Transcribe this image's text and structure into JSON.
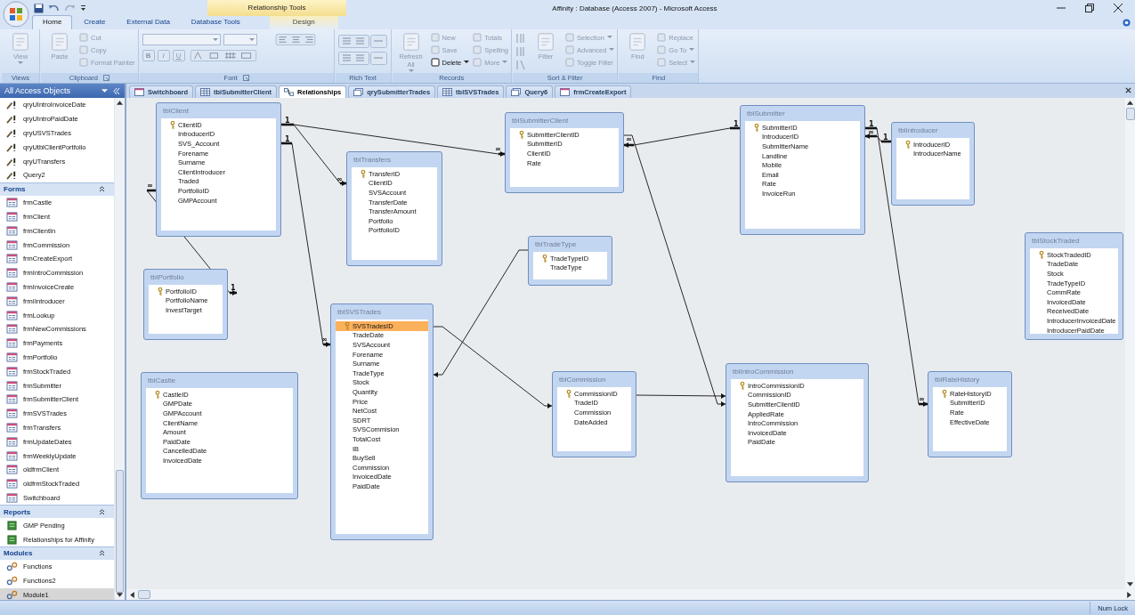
{
  "window": {
    "title": "Affinity : Database (Access 2007)  -  Microsoft Access",
    "context_group": "Relationship Tools"
  },
  "ribbon": {
    "tabs": [
      {
        "label": "Home",
        "selected": true,
        "contextual": false
      },
      {
        "label": "Create",
        "selected": false,
        "contextual": false
      },
      {
        "label": "External Data",
        "selected": false,
        "contextual": false
      },
      {
        "label": "Database Tools",
        "selected": false,
        "contextual": false
      },
      {
        "label": "Design",
        "selected": false,
        "contextual": true
      }
    ],
    "groups": [
      {
        "label": "Views",
        "launcher": false,
        "columns": [
          {
            "kind": "large",
            "items": [
              {
                "label": "View",
                "disabled": true,
                "dropdown": true
              }
            ]
          }
        ]
      },
      {
        "label": "Clipboard",
        "launcher": true,
        "columns": [
          {
            "kind": "large",
            "items": [
              {
                "label": "Paste",
                "disabled": true,
                "dropdown": false
              }
            ]
          },
          {
            "kind": "small",
            "items": [
              {
                "label": "Cut",
                "disabled": true,
                "dropdown": false
              },
              {
                "label": "Copy",
                "disabled": true,
                "dropdown": false
              },
              {
                "label": "Format Painter",
                "disabled": true,
                "dropdown": false
              }
            ]
          }
        ]
      },
      {
        "label": "Font",
        "launcher": true,
        "columns": [
          {
            "kind": "font",
            "items": [
              {
                "label": "B",
                "disabled": true,
                "dropdown": false
              },
              {
                "label": "I",
                "disabled": true,
                "dropdown": false
              },
              {
                "label": "U",
                "disabled": true,
                "dropdown": false
              }
            ]
          }
        ]
      },
      {
        "label": "Rich Text",
        "launcher": false,
        "columns": [
          {
            "kind": "richtext"
          }
        ]
      },
      {
        "label": "Records",
        "launcher": false,
        "columns": [
          {
            "kind": "large",
            "items": [
              {
                "label": "Refresh All",
                "disabled": true,
                "dropdown": true
              }
            ]
          },
          {
            "kind": "small",
            "items": [
              {
                "label": "New",
                "disabled": true,
                "dropdown": false
              },
              {
                "label": "Save",
                "disabled": true,
                "dropdown": false
              },
              {
                "label": "Delete",
                "disabled": false,
                "dropdown": true
              }
            ]
          },
          {
            "kind": "small",
            "items": [
              {
                "label": "Totals",
                "disabled": true,
                "dropdown": false
              },
              {
                "label": "Spelling",
                "disabled": true,
                "dropdown": false
              },
              {
                "label": "More",
                "disabled": true,
                "dropdown": true
              }
            ]
          }
        ]
      },
      {
        "label": "Sort & Filter",
        "launcher": false,
        "columns": [
          {
            "kind": "sort"
          },
          {
            "kind": "large",
            "items": [
              {
                "label": "Filter",
                "disabled": true,
                "dropdown": false
              }
            ]
          },
          {
            "kind": "small",
            "items": [
              {
                "label": "Selection",
                "disabled": true,
                "dropdown": true
              },
              {
                "label": "Advanced",
                "disabled": true,
                "dropdown": true
              },
              {
                "label": "Toggle Filter",
                "disabled": true,
                "dropdown": false
              }
            ]
          }
        ]
      },
      {
        "label": "Find",
        "launcher": false,
        "columns": [
          {
            "kind": "large",
            "items": [
              {
                "label": "Find",
                "disabled": true,
                "dropdown": false
              }
            ]
          },
          {
            "kind": "small",
            "items": [
              {
                "label": "Replace",
                "disabled": true,
                "dropdown": false
              },
              {
                "label": "Go To",
                "disabled": true,
                "dropdown": true
              },
              {
                "label": "Select",
                "disabled": true,
                "dropdown": true
              }
            ]
          }
        ]
      }
    ]
  },
  "navigation": {
    "title": "All Access Objects",
    "groups": [
      {
        "kind": "query",
        "items": [
          {
            "label": "qryUIntroInvoiceDate",
            "selected": false
          },
          {
            "label": "qryUIntroPaidDate",
            "selected": false
          },
          {
            "label": "qryUSVSTrades",
            "selected": false
          },
          {
            "label": "qryUtblClientPortfolio",
            "selected": false
          },
          {
            "label": "qryUTransfers",
            "selected": false
          },
          {
            "label": "Query2",
            "selected": false
          }
        ]
      },
      {
        "title": "Forms",
        "kind": "form",
        "items": [
          {
            "label": "frmCastle",
            "selected": false
          },
          {
            "label": "frmClient",
            "selected": false
          },
          {
            "label": "frmClientIn",
            "selected": false
          },
          {
            "label": "frmCommission",
            "selected": false
          },
          {
            "label": "frmCreateExport",
            "selected": false
          },
          {
            "label": "frmIntroCommission",
            "selected": false
          },
          {
            "label": "frmInvoiceCreate",
            "selected": false
          },
          {
            "label": "frmIIntroducer",
            "selected": false
          },
          {
            "label": "frmLookup",
            "selected": false
          },
          {
            "label": "frmNewCommissions",
            "selected": false
          },
          {
            "label": "frmPayments",
            "selected": false
          },
          {
            "label": "frmPortfolio",
            "selected": false
          },
          {
            "label": "frmStockTraded",
            "selected": false
          },
          {
            "label": "frmSubmitter",
            "selected": false
          },
          {
            "label": "frmSubmitterClient",
            "selected": false
          },
          {
            "label": "frmSVSTrades",
            "selected": false
          },
          {
            "label": "frmTransfers",
            "selected": false
          },
          {
            "label": "frmUpdateDates",
            "selected": false
          },
          {
            "label": "frmWeeklyUpdate",
            "selected": false
          },
          {
            "label": "oldfrmClient",
            "selected": false
          },
          {
            "label": "oldfrmStockTraded",
            "selected": false
          },
          {
            "label": "Switchboard",
            "selected": false
          }
        ]
      },
      {
        "title": "Reports",
        "kind": "report",
        "items": [
          {
            "label": "GMP Pending",
            "selected": false
          },
          {
            "label": "Relationships for Affinity",
            "selected": false
          }
        ]
      },
      {
        "title": "Modules",
        "kind": "module",
        "items": [
          {
            "label": "Functions",
            "selected": false
          },
          {
            "label": "Functions2",
            "selected": false
          },
          {
            "label": "Module1",
            "selected": true
          }
        ]
      }
    ]
  },
  "document_tabs": [
    {
      "label": "Switchboard",
      "kind": "form",
      "selected": false
    },
    {
      "label": "tblSubmitterClient",
      "kind": "table",
      "selected": false
    },
    {
      "label": "Relationships",
      "kind": "relationships",
      "selected": true
    },
    {
      "label": "qrySubmitterTrades",
      "kind": "query",
      "selected": false
    },
    {
      "label": "tblSVSTrades",
      "kind": "table",
      "selected": false
    },
    {
      "label": "Query6",
      "kind": "query",
      "selected": false
    },
    {
      "label": "frmCreateExport",
      "kind": "form",
      "selected": false
    }
  ],
  "tables": [
    {
      "title": "tblClient",
      "fields": [
        {
          "name": "ClientID",
          "key": true,
          "selected": false
        },
        {
          "name": "IntroducerID",
          "key": false,
          "selected": false
        },
        {
          "name": "SVS_Account",
          "key": false,
          "selected": false
        },
        {
          "name": "Forename",
          "key": false,
          "selected": false
        },
        {
          "name": "Surname",
          "key": false,
          "selected": false
        },
        {
          "name": "ClientIntroducer",
          "key": false,
          "selected": false
        },
        {
          "name": "Traded",
          "key": false,
          "selected": false
        },
        {
          "name": "PortfolioID",
          "key": false,
          "selected": false
        },
        {
          "name": "GMPAccount",
          "key": false,
          "selected": false
        }
      ]
    },
    {
      "title": "tblTransfers",
      "fields": [
        {
          "name": "TransferID",
          "key": true,
          "selected": false
        },
        {
          "name": "ClientID",
          "key": false,
          "selected": false
        },
        {
          "name": "SVSAccount",
          "key": false,
          "selected": false
        },
        {
          "name": "TransferDate",
          "key": false,
          "selected": false
        },
        {
          "name": "TransferAmount",
          "key": false,
          "selected": false
        },
        {
          "name": "Portfolio",
          "key": false,
          "selected": false
        },
        {
          "name": "PortfolioID",
          "key": false,
          "selected": false
        }
      ]
    },
    {
      "title": "tblSubmitterClient",
      "fields": [
        {
          "name": "SubmitterClientID",
          "key": true,
          "selected": false
        },
        {
          "name": "SubmitterID",
          "key": false,
          "selected": false
        },
        {
          "name": "ClientID",
          "key": false,
          "selected": false
        },
        {
          "name": "Rate",
          "key": false,
          "selected": false
        }
      ]
    },
    {
      "title": "tblSubmitter",
      "fields": [
        {
          "name": "SubmitterID",
          "key": true,
          "selected": false
        },
        {
          "name": "IntroducerID",
          "key": false,
          "selected": false
        },
        {
          "name": "SubmitterName",
          "key": false,
          "selected": false
        },
        {
          "name": "Landline",
          "key": false,
          "selected": false
        },
        {
          "name": "Mobile",
          "key": false,
          "selected": false
        },
        {
          "name": "Email",
          "key": false,
          "selected": false
        },
        {
          "name": "Rate",
          "key": false,
          "selected": false
        },
        {
          "name": "InvoiceRun",
          "key": false,
          "selected": false
        }
      ]
    },
    {
      "title": "tblIntroducer",
      "fields": [
        {
          "name": "IntroducerID",
          "key": true,
          "selected": false
        },
        {
          "name": "IntroducerName",
          "key": false,
          "selected": false
        }
      ]
    },
    {
      "title": "tblPortfolio",
      "fields": [
        {
          "name": "PortfolioID",
          "key": true,
          "selected": false
        },
        {
          "name": "PortfolioName",
          "key": false,
          "selected": false
        },
        {
          "name": "InvestTarget",
          "key": false,
          "selected": false
        }
      ]
    },
    {
      "title": "tblTradeType",
      "fields": [
        {
          "name": "TradeTypeID",
          "key": true,
          "selected": false
        },
        {
          "name": "TradeType",
          "key": false,
          "selected": false
        }
      ]
    },
    {
      "title": "tblSVSTrades",
      "fields": [
        {
          "name": "SVSTradesID",
          "key": true,
          "selected": true
        },
        {
          "name": "TradeDate",
          "key": false,
          "selected": false
        },
        {
          "name": "SVSAccount",
          "key": false,
          "selected": false
        },
        {
          "name": "Forename",
          "key": false,
          "selected": false
        },
        {
          "name": "Surname",
          "key": false,
          "selected": false
        },
        {
          "name": "TradeType",
          "key": false,
          "selected": false
        },
        {
          "name": "Stock",
          "key": false,
          "selected": false
        },
        {
          "name": "Quantity",
          "key": false,
          "selected": false
        },
        {
          "name": "Price",
          "key": false,
          "selected": false
        },
        {
          "name": "NetCost",
          "key": false,
          "selected": false
        },
        {
          "name": "SDRT",
          "key": false,
          "selected": false
        },
        {
          "name": "SVSCommision",
          "key": false,
          "selected": false
        },
        {
          "name": "TotalCost",
          "key": false,
          "selected": false
        },
        {
          "name": "IB",
          "key": false,
          "selected": false
        },
        {
          "name": "BuySell",
          "key": false,
          "selected": false
        },
        {
          "name": "Commission",
          "key": false,
          "selected": false
        },
        {
          "name": "InvoicedDate",
          "key": false,
          "selected": false
        },
        {
          "name": "PaidDate",
          "key": false,
          "selected": false
        }
      ]
    },
    {
      "title": "tblStockTraded",
      "fields": [
        {
          "name": "StockTradedID",
          "key": true,
          "selected": false
        },
        {
          "name": "TradeDate",
          "key": false,
          "selected": false
        },
        {
          "name": "Stock",
          "key": false,
          "selected": false
        },
        {
          "name": "TradeTypeID",
          "key": false,
          "selected": false
        },
        {
          "name": "CommRate",
          "key": false,
          "selected": false
        },
        {
          "name": "InvoicedDate",
          "key": false,
          "selected": false
        },
        {
          "name": "ReceivedDate",
          "key": false,
          "selected": false
        },
        {
          "name": "IntroducerInvoicedDate",
          "key": false,
          "selected": false
        },
        {
          "name": "IntroducerPaidDate",
          "key": false,
          "selected": false
        }
      ]
    },
    {
      "title": "tblCastle",
      "fields": [
        {
          "name": "CastleID",
          "key": true,
          "selected": false
        },
        {
          "name": "GMPDate",
          "key": false,
          "selected": false
        },
        {
          "name": "GMPAccount",
          "key": false,
          "selected": false
        },
        {
          "name": "ClientName",
          "key": false,
          "selected": false
        },
        {
          "name": "Amount",
          "key": false,
          "selected": false
        },
        {
          "name": "PaidDate",
          "key": false,
          "selected": false
        },
        {
          "name": "CancelledDate",
          "key": false,
          "selected": false
        },
        {
          "name": "InvoicedDate",
          "key": false,
          "selected": false
        }
      ]
    },
    {
      "title": "tblCommission",
      "fields": [
        {
          "name": "CommissionID",
          "key": true,
          "selected": false
        },
        {
          "name": "TradeID",
          "key": false,
          "selected": false
        },
        {
          "name": "Commission",
          "key": false,
          "selected": false
        },
        {
          "name": "DateAdded",
          "key": false,
          "selected": false
        }
      ]
    },
    {
      "title": "tblIntroCommission",
      "fields": [
        {
          "name": "IntroCommissionID",
          "key": true,
          "selected": false
        },
        {
          "name": "CommissionID",
          "key": false,
          "selected": false
        },
        {
          "name": "SubmitterClientID",
          "key": false,
          "selected": false
        },
        {
          "name": "AppliedRate",
          "key": false,
          "selected": false
        },
        {
          "name": "IntroCommission",
          "key": false,
          "selected": false
        },
        {
          "name": "InvoicedDate",
          "key": false,
          "selected": false
        },
        {
          "name": "PaidDate",
          "key": false,
          "selected": false
        }
      ]
    },
    {
      "title": "tblRateHistory",
      "fields": [
        {
          "name": "RateHistoryID",
          "key": true,
          "selected": false
        },
        {
          "name": "SubmitterID",
          "key": false,
          "selected": false
        },
        {
          "name": "Rate",
          "key": false,
          "selected": false
        },
        {
          "name": "EffectiveDate",
          "key": false,
          "selected": false
        }
      ]
    }
  ],
  "relationships": [
    {
      "kind": "enforced",
      "one_label": "1",
      "many_label": "∞"
    },
    {
      "kind": "enforced",
      "one_label": "1",
      "many_label": "∞"
    },
    {
      "kind": "enforced",
      "one_label": "1",
      "many_label": "∞"
    },
    {
      "kind": "enforced",
      "many_label": "∞"
    },
    {
      "kind": "plain"
    },
    {
      "kind": "plain"
    },
    {
      "kind": "enforced",
      "one_label": "1",
      "many_label": "∞"
    },
    {
      "kind": "plain"
    },
    {
      "kind": "plain"
    },
    {
      "kind": "enforced",
      "one_label": "1",
      "many_label": "∞"
    },
    {
      "kind": "enforced",
      "one_label": "1",
      "many_label": "∞"
    }
  ],
  "status_bar": {
    "indicator": "Num Lock"
  }
}
